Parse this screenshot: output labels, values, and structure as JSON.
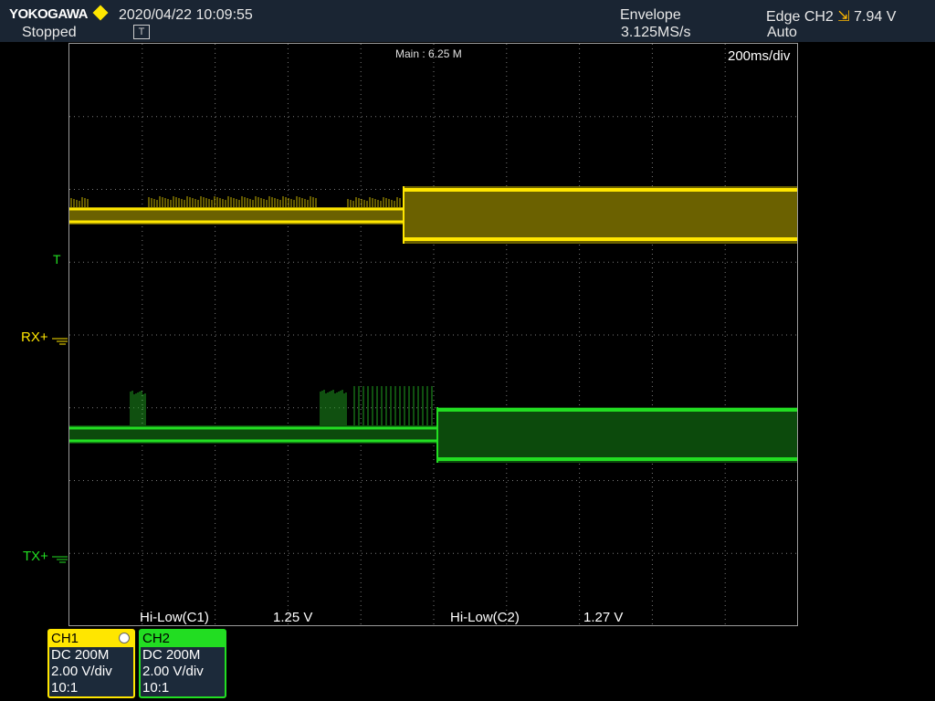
{
  "header": {
    "brand": "YOKOGAWA",
    "datetime": "2020/04/22 10:09:55",
    "run_state": "Stopped",
    "trigger_marker": "T",
    "acq_mode": "Envelope",
    "sample_rate": "3.125MS/s",
    "trigger_source": "Edge CH2",
    "trigger_level": "7.94 V",
    "trigger_mode": "Auto"
  },
  "display": {
    "main_record": "Main : 6.25 M",
    "time_div": "200ms/div"
  },
  "markers": {
    "trigger_level_glyph": "T",
    "ch1_label": "RX+",
    "ch2_label": "TX+"
  },
  "measurements": [
    {
      "name": "Hi-Low(C1)",
      "value": "1.25 V"
    },
    {
      "name": "Hi-Low(C2)",
      "value": "1.27 V"
    }
  ],
  "channels": [
    {
      "name": "CH1",
      "coupling": "DC 200M",
      "vdiv": "2.00 V/div",
      "probe": "10:1",
      "color": "#ffe600"
    },
    {
      "name": "CH2",
      "coupling": "DC 200M",
      "vdiv": "2.00 V/div",
      "probe": "10:1",
      "color": "#22dd22"
    }
  ]
}
